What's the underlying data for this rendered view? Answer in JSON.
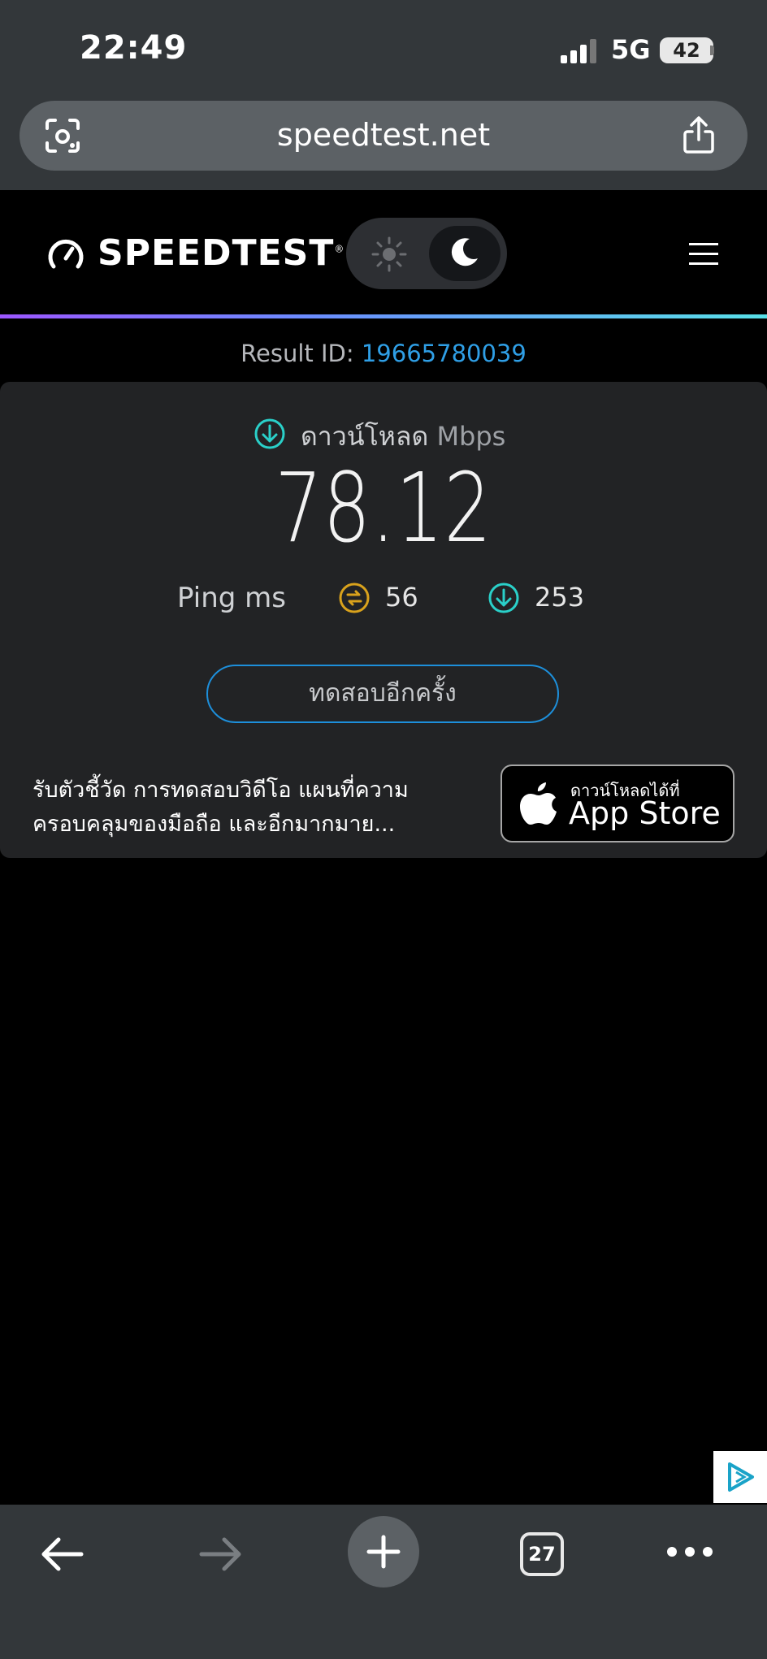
{
  "status_bar": {
    "time": "22:49",
    "network": "5G",
    "battery": "42"
  },
  "browser": {
    "url": "speedtest.net",
    "tab_count": "27"
  },
  "site": {
    "logo_text": "SPEEDTEST",
    "logo_mark": "®"
  },
  "result": {
    "id_label": "Result ID: ",
    "id_value": "19665780039"
  },
  "download": {
    "label": "ดาวน์โหลด",
    "unit": "Mbps",
    "value": "78.12"
  },
  "ping": {
    "label": "Ping ms",
    "jitter": "56",
    "download_ping": "253"
  },
  "actions": {
    "test_again": "ทดสอบอีกครั้ง"
  },
  "promo": {
    "text_line1": "รับตัวชี้วัด การทดสอบวิดีโอ แผนที่ความ",
    "text_line2": "ครอบคลุมของมือถือ และอีกมากมาย..."
  },
  "appstore": {
    "small_text": "ดาวน์โหลดได้ที่",
    "big_text": "App Store"
  },
  "colors": {
    "accent_blue": "#1d8fdb",
    "teal": "#2ad0c9",
    "gold": "#d9a21c",
    "chrome": "#33373a"
  }
}
